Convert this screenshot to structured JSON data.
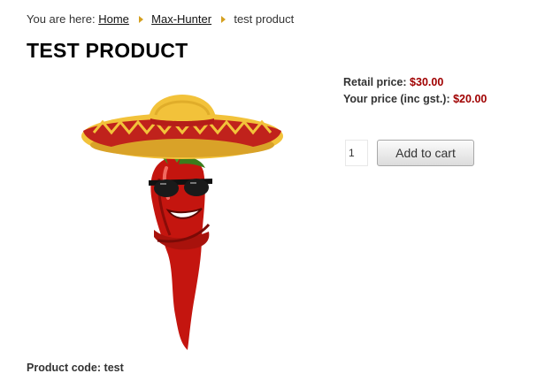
{
  "breadcrumb": {
    "prefix": "You are here:",
    "items": [
      {
        "label": "Home"
      },
      {
        "label": "Max-Hunter"
      }
    ],
    "current": "test product"
  },
  "product": {
    "title": "TEST PRODUCT",
    "image_icon": "chili-pepper-sombrero-icon",
    "retail_label": "Retail price:",
    "retail_value": "$30.00",
    "your_price_label": "Your price (inc gst.):",
    "your_price_value": "$20.00",
    "code_label": "Product code:",
    "code_value": "test"
  },
  "cart": {
    "quantity": "1",
    "add_label": "Add to cart"
  },
  "colors": {
    "price_red": "#a00000",
    "separator_gold": "#d4a020"
  }
}
